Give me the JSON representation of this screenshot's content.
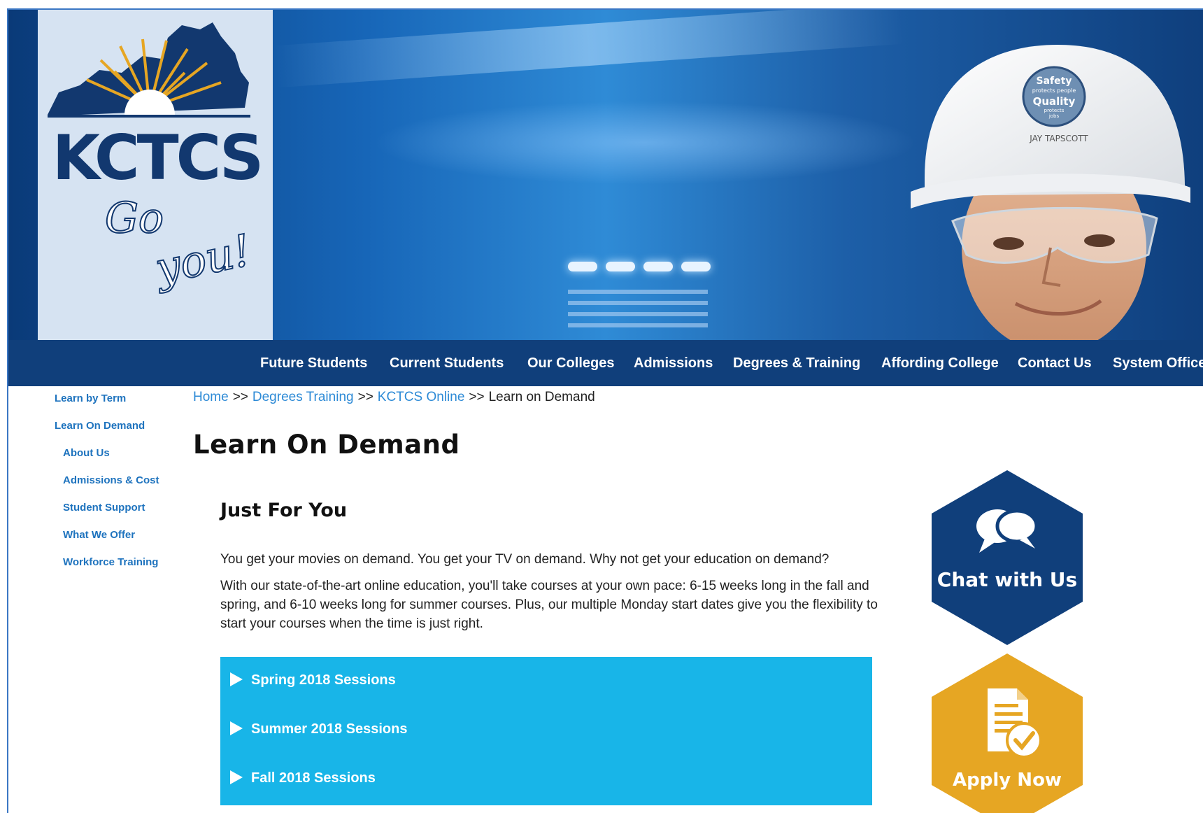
{
  "brand": {
    "logo_text": "KCTCS",
    "tagline_go": "Go",
    "tagline_you": "you!",
    "helmet_sticker": [
      "Safety",
      "protects people",
      "Quality",
      "protects",
      "jobs"
    ],
    "helmet_name": "JAY TAPSCOTT",
    "colors": {
      "navy": "#103f7b",
      "accent_blue": "#18b5e8",
      "link_blue": "#2d8ad6",
      "gold": "#e6a623"
    }
  },
  "nav": {
    "items": [
      "Future Students",
      "Current Students",
      "Our Colleges",
      "Admissions",
      "Degrees & Training",
      "Affording College",
      "Contact Us",
      "System Office"
    ]
  },
  "sidebar": {
    "items": [
      {
        "label": "Learn by Term",
        "level": 0
      },
      {
        "label": "Learn On Demand",
        "level": 0
      },
      {
        "label": "About Us",
        "level": 1
      },
      {
        "label": "Admissions & Cost",
        "level": 1
      },
      {
        "label": "Student Support",
        "level": 1
      },
      {
        "label": "What We Offer",
        "level": 1
      },
      {
        "label": "Workforce Training",
        "level": 1
      }
    ]
  },
  "breadcrumb": {
    "items": [
      "Home",
      "Degrees Training",
      "KCTCS Online"
    ],
    "separator": ">>",
    "current": "Learn on Demand"
  },
  "main": {
    "title": "Learn On Demand",
    "section_title": "Just For You",
    "paragraphs": [
      "You get your movies on demand. You get your TV on demand. Why not get your education on demand?",
      "With our state-of-the-art online education, you'll take courses at your own pace: 6-15 weeks long in the fall and spring, and 6-10 weeks long for summer courses. Plus, our multiple Monday start dates give you the flexibility to start your courses when the time is just right."
    ],
    "sessions": [
      "Spring 2018 Sessions",
      "Summer 2018 Sessions",
      "Fall 2018 Sessions"
    ]
  },
  "actions": {
    "chat_label": "Chat with Us",
    "chat_icon": "chat-bubbles-icon",
    "apply_label": "Apply Now",
    "apply_icon": "document-check-icon"
  }
}
